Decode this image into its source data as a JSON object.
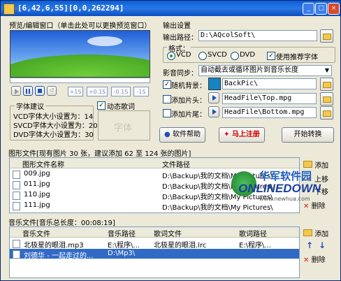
{
  "window": {
    "title": "[6,42,6,55][0,0,262294]"
  },
  "preview": {
    "group_label": "预览/编辑窗口（单击此处可以更换预览窗口）",
    "controls": [
      "+1S",
      "+0.1S",
      "-0.1S",
      "-1S"
    ]
  },
  "font_suggest": {
    "label": "字体建议",
    "vcd": "VCD字体大小设置为：14",
    "svcd": "SVCD字体大小设置为：20",
    "dvd": "DVD字体大小设置为：30",
    "sample": "字体"
  },
  "dynamic_lyrics": {
    "label": "动态歌词",
    "checked": true
  },
  "output": {
    "group_label": "输出设置",
    "path_label": "输出路径：",
    "path_value": "D:\\AQcolSoft\\",
    "format_label": "格式：",
    "formats": [
      "VCD",
      "SVCD",
      "DVD"
    ],
    "selected_format": "VCD",
    "recommend_font_label": "使用推荐字体"
  },
  "sync": {
    "label": "影音同步：",
    "value": "自动截去或循环图片到音乐长度"
  },
  "background": {
    "label": "随机背景：",
    "value": "BackPic\\"
  },
  "head": {
    "label": "添加片头：",
    "value": "HeadFile\\Top.mpg"
  },
  "tail": {
    "label": "添加片尾：",
    "value": "HeadFile\\Bottom.mpg"
  },
  "buttons": {
    "help": "软件帮助",
    "register": "马上注册",
    "convert": "开始转换"
  },
  "images": {
    "group_label": "图形文件[现有图片 30 张，建议添加 62 至 124 张的图片]",
    "columns": [
      "图形文件名称",
      "文件路径"
    ],
    "rows": [
      {
        "name": "009.jpg",
        "path": "D:\\Backup\\我的文档\\My Pictures\\"
      },
      {
        "name": "011.jpg",
        "path": "D:\\Backup\\我的文档\\My Pictures\\"
      },
      {
        "name": "110.jpg",
        "path": "D:\\Backup\\我的文档\\My Pictures\\"
      },
      {
        "name": "111.jpg",
        "path": "D:\\Backup\\我的文档\\My Pictures\\"
      }
    ],
    "side": {
      "add": "添加",
      "up": "上移",
      "down": "下移",
      "delete": "删除"
    }
  },
  "music": {
    "group_label": "音乐文件[音乐总长度：00:08:19]",
    "columns": [
      "音乐文件",
      "音乐路径",
      "歌词文件",
      "歌词路径"
    ],
    "rows": [
      {
        "name": "北极星的眼泪.mp3",
        "path": "E:\\程序\\...",
        "lyric": "北极星的眼泪.lrc",
        "lyric_path": "E:\\程序\\..."
      },
      {
        "name": "刘德华 - 一起走过的...",
        "path": "D:\\Mp3\\",
        "lyric": "",
        "lyric_path": ""
      }
    ],
    "selected_row": 1,
    "side": {
      "add": "添加",
      "delete": "删除"
    }
  },
  "watermark": {
    "line1": "华军软件园",
    "line2": "ONLINEDOWN",
    "line3": "www.newhua.com"
  }
}
